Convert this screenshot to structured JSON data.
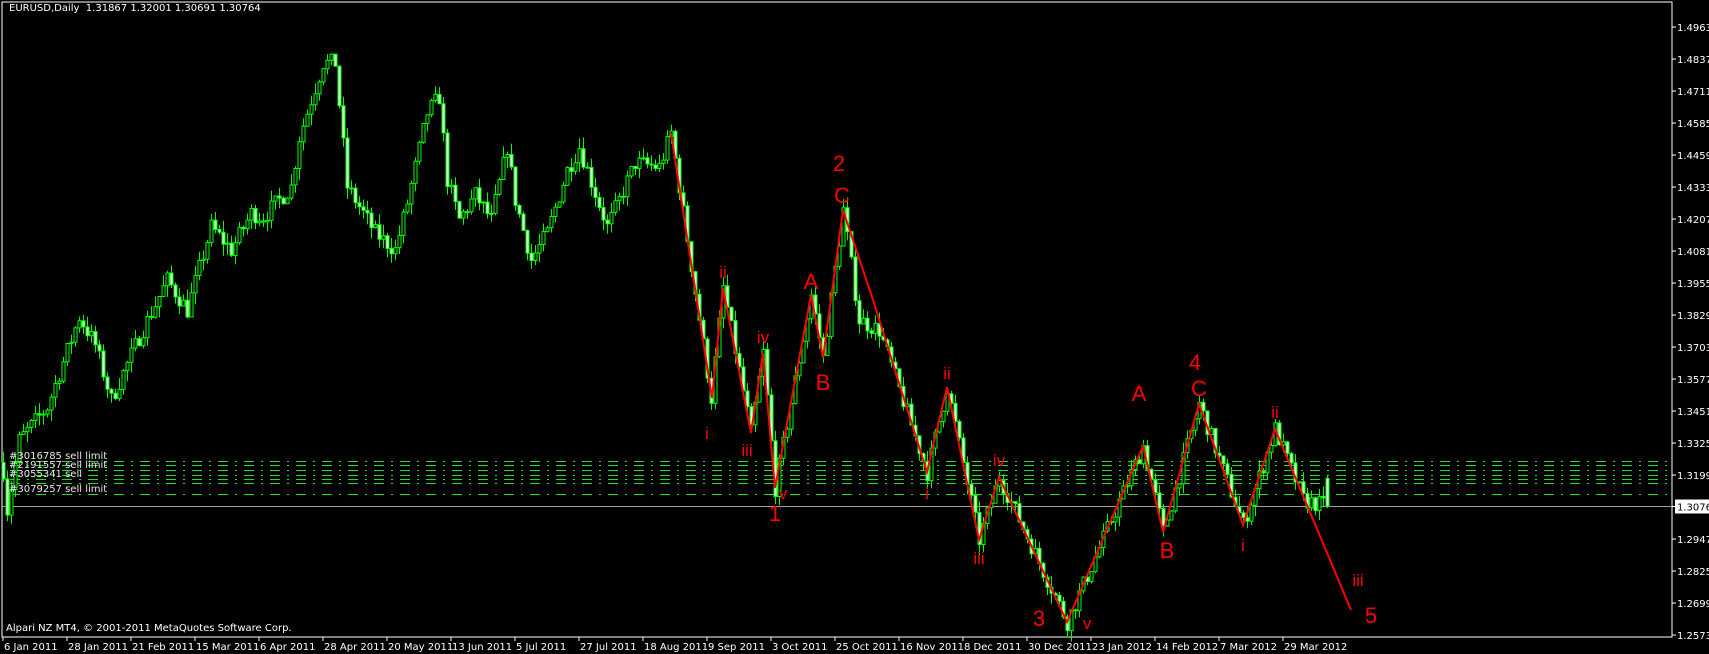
{
  "header": {
    "symbol_timeframe": "EURUSD,Daily",
    "ohlc": "1.31867 1.32001 1.30691 1.30764"
  },
  "copyright": "Alpari NZ MT4, © 2001-2011 MetaQuotes Software Corp.",
  "colors": {
    "background": "#000000",
    "candle": "#00ff00",
    "bear_fill": "#d8ffd8",
    "wave": "#ff0000",
    "order_line": "#22dd22",
    "axis": "#ffffff",
    "price_line": "#a0a0a0"
  },
  "chart_data": {
    "type": "candlestick",
    "symbol": "EURUSD",
    "timeframe": "Daily",
    "last_candle": {
      "open": 1.31867,
      "high": 1.32001,
      "low": 1.30691,
      "close": 1.30764
    },
    "current_price": "1.30764",
    "ylim": [
      1.2573,
      1.49635
    ],
    "y_ticks": [
      "1.49635",
      "1.48375",
      "1.47115",
      "1.45855",
      "1.44595",
      "1.43335",
      "1.42075",
      "1.40815",
      "1.39555",
      "1.38295",
      "1.37035",
      "1.35775",
      "1.34515",
      "1.33255",
      "1.31995",
      "1.30764",
      "1.29475",
      "1.28250",
      "1.26990",
      "1.25730"
    ],
    "x_ticks": [
      "6 Jan 2011",
      "28 Jan 2011",
      "21 Feb 2011",
      "15 Mar 2011",
      "6 Apr 2011",
      "28 Apr 2011",
      "20 May 2011",
      "13 Jun 2011",
      "5 Jul 2011",
      "27 Jul 2011",
      "18 Aug 2011",
      "9 Sep 2011",
      "3 Oct 2011",
      "25 Oct 2011",
      "16 Nov 2011",
      "8 Dec 2011",
      "30 Dec 2011",
      "23 Jan 2012",
      "14 Feb 2012",
      "7 Mar 2012",
      "29 Mar 2012"
    ],
    "bars_per_tick": 16,
    "price_path": [
      [
        0,
        1.3219
      ],
      [
        1,
        1.3062
      ],
      [
        4,
        1.3337
      ],
      [
        11,
        1.3467
      ],
      [
        19,
        1.3822
      ],
      [
        23,
        1.3711
      ],
      [
        27,
        1.3495
      ],
      [
        34,
        1.3743
      ],
      [
        41,
        1.3967
      ],
      [
        46,
        1.3849
      ],
      [
        52,
        1.4176
      ],
      [
        57,
        1.4085
      ],
      [
        62,
        1.4231
      ],
      [
        65,
        1.4215
      ],
      [
        72,
        1.4334
      ],
      [
        74,
        1.453
      ],
      [
        80,
        1.4822
      ],
      [
        83,
        1.4822
      ],
      [
        86,
        1.4334
      ],
      [
        91,
        1.4204
      ],
      [
        93,
        1.4152
      ],
      [
        98,
        1.4085
      ],
      [
        101,
        1.4271
      ],
      [
        106,
        1.4625
      ],
      [
        109,
        1.4688
      ],
      [
        111,
        1.4361
      ],
      [
        114,
        1.4204
      ],
      [
        118,
        1.4302
      ],
      [
        122,
        1.4204
      ],
      [
        126,
        1.4491
      ],
      [
        128,
        1.4282
      ],
      [
        132,
        1.4046
      ],
      [
        136,
        1.4152
      ],
      [
        141,
        1.44
      ],
      [
        144,
        1.4491
      ],
      [
        148,
        1.431
      ],
      [
        151,
        1.4176
      ],
      [
        154,
        1.4282
      ],
      [
        158,
        1.4428
      ],
      [
        164,
        1.4412
      ],
      [
        167,
        1.4546
      ],
      [
        177,
        1.3503
      ],
      [
        180,
        1.3936
      ],
      [
        187,
        1.3365
      ],
      [
        190,
        1.368
      ],
      [
        193,
        1.3148
      ],
      [
        202,
        1.3908
      ],
      [
        205,
        1.366
      ],
      [
        210,
        1.4243
      ],
      [
        214,
        1.381
      ],
      [
        219,
        1.377
      ],
      [
        231,
        1.3211
      ],
      [
        236,
        1.3546
      ],
      [
        244,
        1.2944
      ],
      [
        249,
        1.3192
      ],
      [
        266,
        1.2621
      ],
      [
        285,
        1.3314
      ],
      [
        290,
        1.2975
      ],
      [
        299,
        1.3479
      ],
      [
        310,
        1.3003
      ],
      [
        318,
        1.3381
      ],
      [
        325,
        1.3101
      ],
      [
        331,
        1.30764
      ]
    ],
    "orders": [
      {
        "label": "#3016785 sell limit",
        "price": 1.3255
      },
      {
        "label": "",
        "price": 1.324
      },
      {
        "label": "#2191557 sell limit",
        "price": 1.3219
      },
      {
        "label": "",
        "price": 1.32
      },
      {
        "label": "#3055341 sell",
        "price": 1.3184
      },
      {
        "label": "",
        "price": 1.3168
      },
      {
        "label": "#3079257 sell limit",
        "price": 1.3125
      }
    ],
    "wave_labels": [
      "i",
      "ii",
      "iii",
      "iv",
      "v",
      "1",
      "A",
      "B",
      "C",
      "2",
      "i",
      "ii",
      "iii",
      "iv",
      "3",
      "v",
      "A",
      "B",
      "C",
      "4",
      "i",
      "ii",
      "iii",
      "5"
    ]
  }
}
